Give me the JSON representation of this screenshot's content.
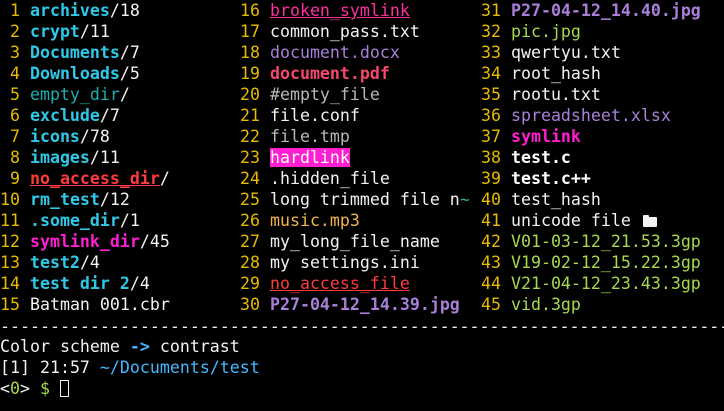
{
  "columns": [
    {
      "entries": [
        {
          "num": "1",
          "name": "archives",
          "style": "dir",
          "suffix": "/18"
        },
        {
          "num": "2",
          "name": "crypt",
          "style": "dir",
          "suffix": "/11"
        },
        {
          "num": "3",
          "name": "Documents",
          "style": "dir",
          "suffix": "/7"
        },
        {
          "num": "4",
          "name": "Downloads",
          "style": "dir",
          "suffix": "/5"
        },
        {
          "num": "5",
          "name": "empty_dir",
          "style": "teal",
          "suffix": "/"
        },
        {
          "num": "6",
          "name": "exclude",
          "style": "dir",
          "suffix": "/7"
        },
        {
          "num": "7",
          "name": "icons",
          "style": "dir",
          "suffix": "/78"
        },
        {
          "num": "8",
          "name": "images",
          "style": "dir",
          "suffix": "/11"
        },
        {
          "num": "9",
          "name": "no_access_dir",
          "style": "red-bold-ul",
          "suffix": "/"
        },
        {
          "num": "10",
          "name": "rm_test",
          "style": "dir",
          "suffix": "/12"
        },
        {
          "num": "11",
          "name": ".some_dir",
          "style": "dir",
          "suffix": "/1"
        },
        {
          "num": "12",
          "name": "symlink_dir",
          "style": "dir-magenta",
          "suffix": "/45"
        },
        {
          "num": "13",
          "name": "test2",
          "style": "dir",
          "suffix": "/4"
        },
        {
          "num": "14",
          "name": "test dir 2",
          "style": "dir",
          "suffix": "/4"
        },
        {
          "num": "15",
          "name": "Batman 001.cbr",
          "style": "plain",
          "suffix": ""
        }
      ]
    },
    {
      "entries": [
        {
          "num": "16",
          "name": "broken_symlink",
          "style": "pink-ul",
          "suffix": ""
        },
        {
          "num": "17",
          "name": "common_pass.txt",
          "style": "plain",
          "suffix": ""
        },
        {
          "num": "18",
          "name": "document.docx",
          "style": "purple",
          "suffix": ""
        },
        {
          "num": "19",
          "name": "document.pdf",
          "style": "red-bold",
          "suffix": ""
        },
        {
          "num": "20",
          "name": "#empty_file",
          "style": "gray",
          "suffix": ""
        },
        {
          "num": "21",
          "name": "file.conf",
          "style": "plain",
          "suffix": ""
        },
        {
          "num": "22",
          "name": "file.tmp",
          "style": "gray",
          "suffix": ""
        },
        {
          "num": "23",
          "name": "hardlink",
          "style": "hardlink-bg",
          "suffix": ""
        },
        {
          "num": "24",
          "name": ".hidden_file",
          "style": "plain",
          "suffix": ""
        },
        {
          "num": "25",
          "name": "long trimmed file n",
          "style": "plain",
          "suffix": "~"
        },
        {
          "num": "26",
          "name": "music.mp3",
          "style": "orange",
          "suffix": ""
        },
        {
          "num": "27",
          "name": "my_long_file_name",
          "style": "plain",
          "suffix": ""
        },
        {
          "num": "28",
          "name": "my settings.ini",
          "style": "plain",
          "suffix": ""
        },
        {
          "num": "29",
          "name": "no_access_file",
          "style": "red-ul",
          "suffix": ""
        },
        {
          "num": "30",
          "name": "P27-04-12_14.39.jpg",
          "style": "purple-bold",
          "suffix": ""
        }
      ]
    },
    {
      "entries": [
        {
          "num": "31",
          "name": "P27-04-12_14.40.jpg",
          "style": "purple-bold",
          "suffix": ""
        },
        {
          "num": "32",
          "name": "pic.jpg",
          "style": "green",
          "suffix": ""
        },
        {
          "num": "33",
          "name": "qwertyu.txt",
          "style": "plain",
          "suffix": ""
        },
        {
          "num": "34",
          "name": "root_hash",
          "style": "plain",
          "suffix": ""
        },
        {
          "num": "35",
          "name": "rootu.txt",
          "style": "plain",
          "suffix": ""
        },
        {
          "num": "36",
          "name": "spreadsheet.xlsx",
          "style": "purple",
          "suffix": ""
        },
        {
          "num": "37",
          "name": "symlink",
          "style": "dir-magenta",
          "suffix": ""
        },
        {
          "num": "38",
          "name": "test.c",
          "style": "bold-white",
          "suffix": ""
        },
        {
          "num": "39",
          "name": "test.c++",
          "style": "bold-white",
          "suffix": ""
        },
        {
          "num": "40",
          "name": "test_hash",
          "style": "plain",
          "suffix": ""
        },
        {
          "num": "41",
          "name": "unicode file ",
          "style": "plain",
          "suffix": "",
          "icon": "folder-open-icon"
        },
        {
          "num": "42",
          "name": "V01-03-12_21.53.3gp",
          "style": "green",
          "suffix": ""
        },
        {
          "num": "43",
          "name": "V19-02-12_15.22.3gp",
          "style": "green",
          "suffix": ""
        },
        {
          "num": "44",
          "name": "V21-04-12_23.43.3gp",
          "style": "green",
          "suffix": ""
        },
        {
          "num": "45",
          "name": "vid.3gp",
          "style": "green",
          "suffix": ""
        }
      ]
    }
  ],
  "divider": "----------------------------------------------------------------------------------------------------",
  "status": {
    "prefix": "Color scheme ",
    "arrow": "->",
    "value": " contrast"
  },
  "context": {
    "tab": "[1]",
    "time": " 21:57 ",
    "path": "~/Documents/test"
  },
  "prompt": {
    "open": "<",
    "ctx": "0",
    "close": ">",
    "dollar": " $ "
  },
  "colors": {
    "background": "#000000",
    "number": "#e6bb00",
    "directory": "#2fc9e8",
    "symlink": "#ff1fd1",
    "path": "#46b8ff"
  }
}
